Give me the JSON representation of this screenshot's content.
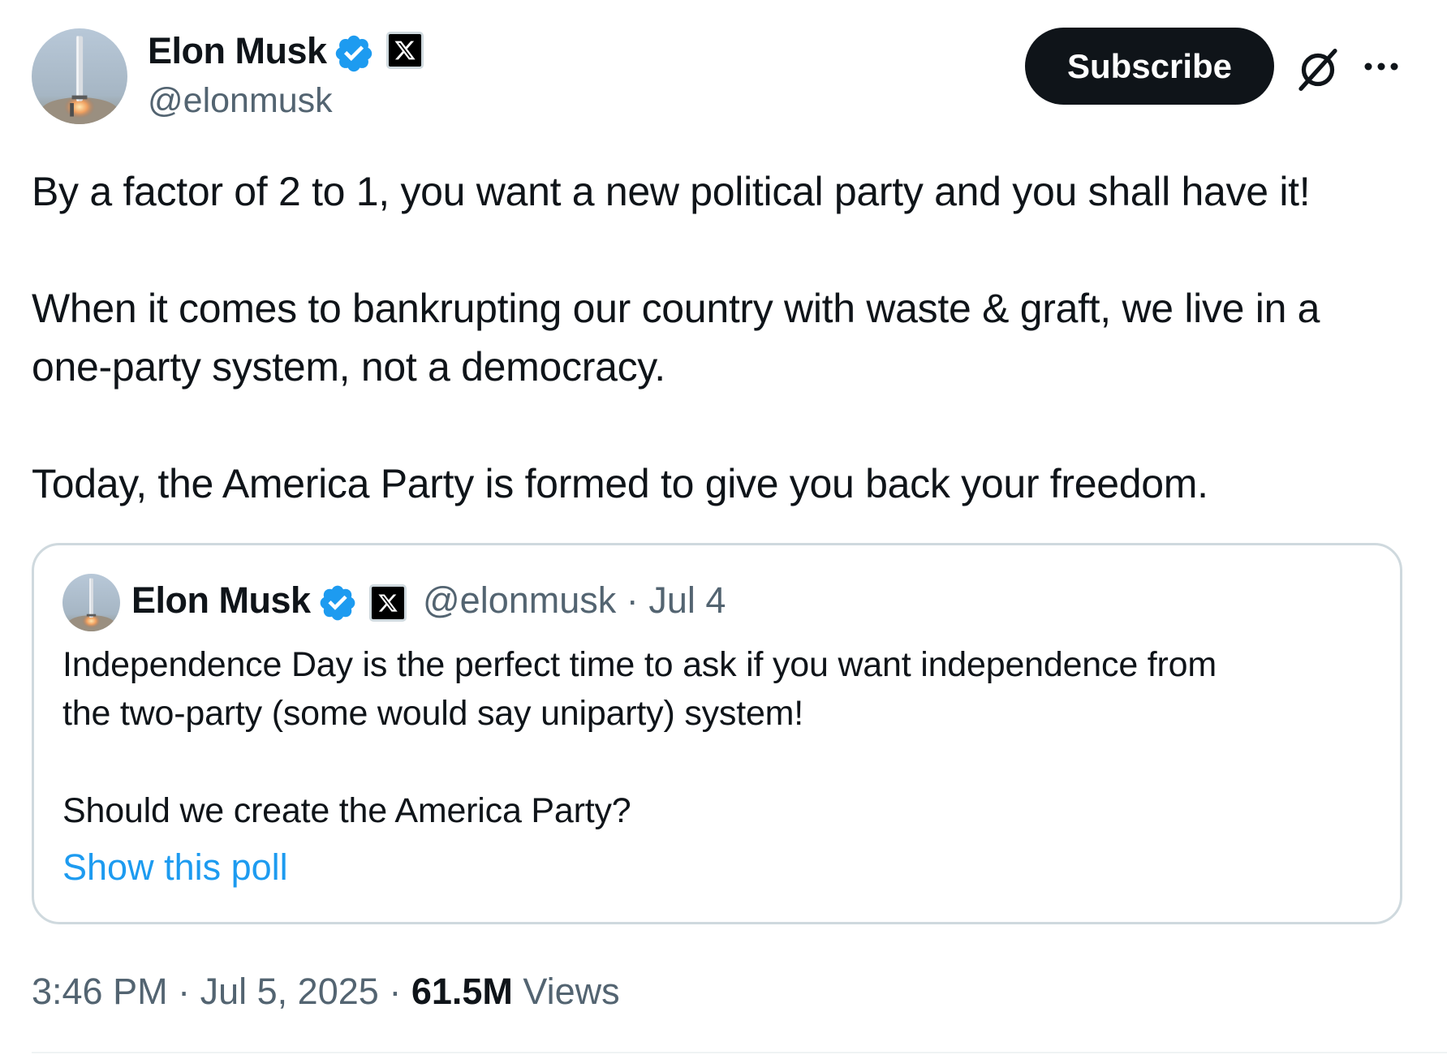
{
  "author": {
    "name": "Elon Musk",
    "handle": "@elonmusk",
    "avatar_icon": "rocket-launch-avatar",
    "verified_icon": "verified-badge-icon",
    "affiliation_icon": "x-logo-icon"
  },
  "header": {
    "subscribe_label": "Subscribe",
    "grok_icon": "grok-icon",
    "more_icon": "more-options-icon"
  },
  "tweet": {
    "lines": [
      "By a factor of 2 to 1, you want a new political party and you shall have it!",
      "When it comes to bankrupting our country with waste & graft, we live in a",
      "one-party system, not a democracy.",
      "Today, the America Party is formed to give you back your freedom."
    ]
  },
  "quote": {
    "name": "Elon Musk",
    "handle": "@elonmusk",
    "separator": "·",
    "date": "Jul 4",
    "lines": [
      "Independence Day is the perfect time to ask if you want independence from",
      "the two-party (some would say uniparty) system!",
      "Should we create the America Party?"
    ],
    "show_poll_label": "Show this poll"
  },
  "footer": {
    "time": "3:46 PM",
    "separator": "·",
    "date": "Jul 5, 2025",
    "views_count": "61.5M",
    "views_label": "Views"
  },
  "colors": {
    "text_primary": "#0f1419",
    "text_secondary": "#536471",
    "accent_blue": "#1d9bf0",
    "border": "#cfd9de",
    "button_bg": "#0f1419"
  }
}
